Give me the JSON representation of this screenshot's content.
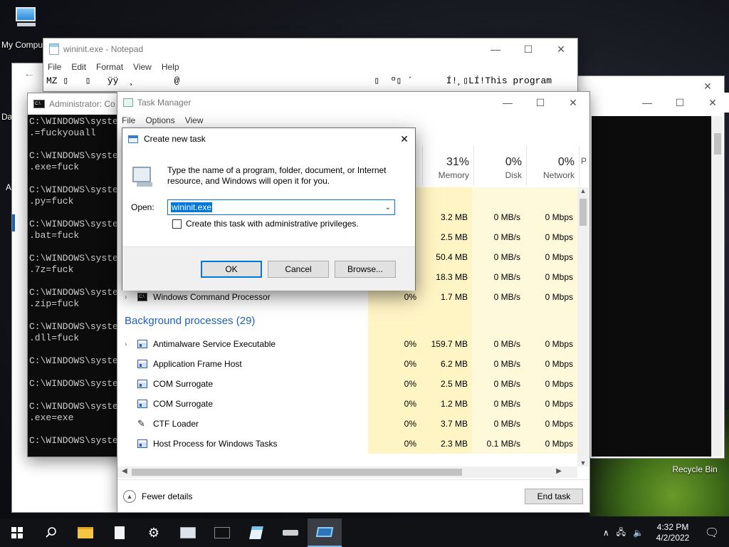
{
  "desktop": {
    "my_computer": "My Compu",
    "recycle_bin": "Recycle Bin",
    "edge_partial": [
      "Da",
      "A"
    ]
  },
  "notepad": {
    "title": "wininit.exe - Notepad",
    "menu": [
      "File",
      "Edit",
      "Format",
      "View",
      "Help"
    ],
    "content": "MZ ▯   ▯   ÿÿ  ¸       @                                   ▯  º▯ ´      Í!¸▯LÍ!This program"
  },
  "cmd": {
    "title": "Administrator: Co",
    "lines": [
      "C:\\WINDOWS\\syste",
      ".=fuckyouall",
      "",
      "C:\\WINDOWS\\syste",
      ".exe=fuck",
      "",
      "C:\\WINDOWS\\syste",
      ".py=fuck",
      "",
      "C:\\WINDOWS\\syste",
      ".bat=fuck",
      "",
      "C:\\WINDOWS\\syste",
      ".7z=fuck",
      "",
      "C:\\WINDOWS\\syste",
      ".zip=fuck",
      "",
      "C:\\WINDOWS\\syste",
      ".dll=fuck",
      "",
      "C:\\WINDOWS\\syste",
      "",
      "C:\\WINDOWS\\syste",
      "",
      "C:\\WINDOWS\\syste",
      ".exe=exe",
      "",
      "C:\\WINDOWS\\syste"
    ]
  },
  "task_manager": {
    "title": "Task Manager",
    "menu": [
      "File",
      "Options",
      "View"
    ],
    "columns": [
      {
        "pct": "",
        "label": ""
      },
      {
        "pct": "31%",
        "label": "Memory"
      },
      {
        "pct": "0%",
        "label": "Disk"
      },
      {
        "pct": "0%",
        "label": "Network"
      },
      {
        "pct": "",
        "label": "P"
      }
    ],
    "app_rows": [
      {
        "cpu": "",
        "memory": "3.2 MB",
        "disk": "0 MB/s",
        "network": "0 Mbps"
      },
      {
        "cpu": "",
        "memory": "2.5 MB",
        "disk": "0 MB/s",
        "network": "0 Mbps"
      },
      {
        "cpu": "",
        "memory": "50.4 MB",
        "disk": "0 MB/s",
        "network": "0 Mbps"
      },
      {
        "cpu": "",
        "memory": "18.3 MB",
        "disk": "0 MB/s",
        "network": "0 Mbps"
      }
    ],
    "cmd_row": {
      "name": "Windows Command Processor",
      "cpu": "0%",
      "memory": "1.7 MB",
      "disk": "0 MB/s",
      "network": "0 Mbps"
    },
    "section_title": "Background processes (29)",
    "bg_rows": [
      {
        "name": "Antimalware Service Executable",
        "cpu": "0%",
        "memory": "159.7 MB",
        "disk": "0 MB/s",
        "network": "0 Mbps",
        "expand": true,
        "icon": "process-icon"
      },
      {
        "name": "Application Frame Host",
        "cpu": "0%",
        "memory": "6.2 MB",
        "disk": "0 MB/s",
        "network": "0 Mbps",
        "expand": false,
        "icon": "process-icon"
      },
      {
        "name": "COM Surrogate",
        "cpu": "0%",
        "memory": "2.5 MB",
        "disk": "0 MB/s",
        "network": "0 Mbps",
        "expand": false,
        "icon": "process-icon"
      },
      {
        "name": "COM Surrogate",
        "cpu": "0%",
        "memory": "1.2 MB",
        "disk": "0 MB/s",
        "network": "0 Mbps",
        "expand": false,
        "icon": "process-icon"
      },
      {
        "name": "CTF Loader",
        "cpu": "0%",
        "memory": "3.7 MB",
        "disk": "0 MB/s",
        "network": "0 Mbps",
        "expand": false,
        "icon": "pen-icon"
      },
      {
        "name": "Host Process for Windows Tasks",
        "cpu": "0%",
        "memory": "2.3 MB",
        "disk": "0.1 MB/s",
        "network": "0 Mbps",
        "expand": false,
        "icon": "process-icon"
      }
    ],
    "fewer_details": "Fewer details",
    "end_task": "End task"
  },
  "dialog": {
    "title": "Create new task",
    "description": "Type the name of a program, folder, document, or Internet resource, and Windows will open it for you.",
    "open_label": "Open:",
    "open_value": "wininit.exe",
    "admin_checkbox": "Create this task with administrative privileges.",
    "ok": "OK",
    "cancel": "Cancel",
    "browse": "Browse..."
  },
  "taskbar": {
    "time": "4:32 PM",
    "date": "4/2/2022"
  }
}
